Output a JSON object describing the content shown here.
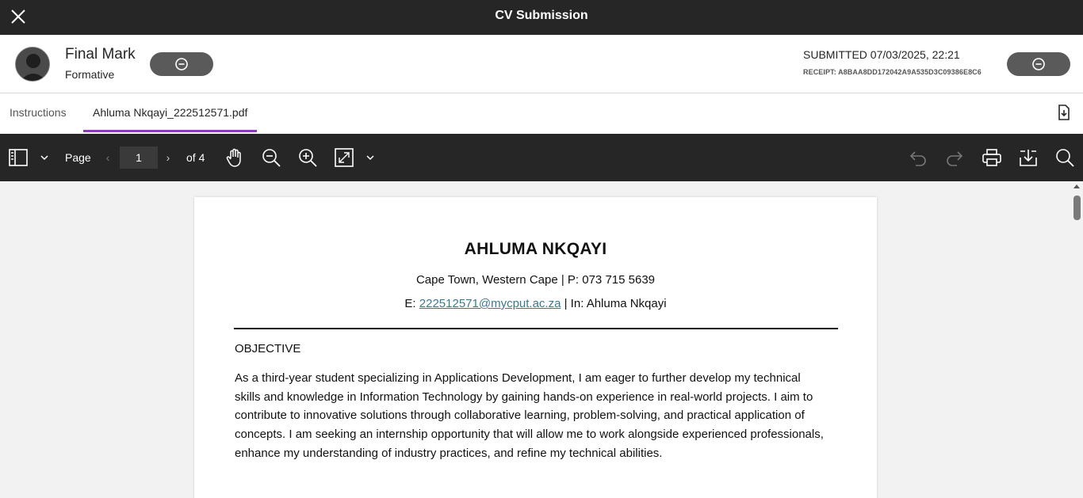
{
  "window": {
    "title": "CV Submission"
  },
  "header": {
    "mark_title": "Final Mark",
    "mark_subtitle": "Formative",
    "submitted": "SUBMITTED 07/03/2025, 22:21",
    "receipt": "RECEIPT: A8BAA8DD172042A9A535D3C09386E8C6"
  },
  "tabs": [
    {
      "label": "Instructions",
      "active": false
    },
    {
      "label": "Ahluma Nkqayi_222512571.pdf",
      "active": true
    }
  ],
  "toolbar": {
    "page_label": "Page",
    "current_page": "1",
    "page_of": "of 4",
    "icons": [
      "sidebar-toggle-icon",
      "chevron-down-icon",
      "pan-hand-icon",
      "zoom-out-icon",
      "zoom-in-icon",
      "fit-page-icon",
      "undo-icon",
      "redo-icon",
      "print-icon",
      "download-icon",
      "search-icon"
    ]
  },
  "document": {
    "name": "AHLUMA NKQAYI",
    "contact_line1": "Cape Town, Western Cape | P: 073 715 5639",
    "email_prefix": "E: ",
    "email": "222512571@mycput.ac.za",
    "linkedin": " | In: Ahluma Nkqayi",
    "section_heading": "OBJECTIVE",
    "objective_text": "As a third-year student specializing in Applications Development, I am eager to further develop my technical skills and knowledge in Information Technology by gaining hands-on experience in real-world projects. I aim to contribute to innovative solutions through collaborative learning, problem-solving, and practical application of concepts. I am seeking an internship opportunity that will allow me to work alongside experienced professionals, enhance my understanding of industry practices, and refine my technical abilities."
  },
  "colors": {
    "titlebar": "#262626",
    "tab_accent": "#8a3db5",
    "link": "#3b7a8c",
    "pill": "#5a5a5a"
  }
}
